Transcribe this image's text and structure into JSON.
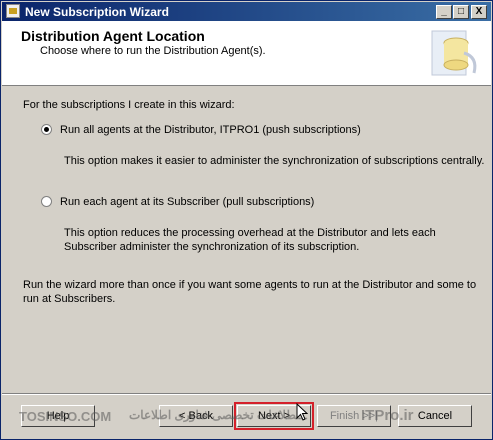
{
  "window": {
    "title": "New Subscription Wizard"
  },
  "title_buttons": {
    "minimize": "_",
    "maximize": "□",
    "close": "X"
  },
  "header": {
    "title": "Distribution Agent Location",
    "subtitle": "Choose where to run the Distribution Agent(s)."
  },
  "main": {
    "intro": "For the subscriptions I create in this wizard:",
    "option1": {
      "label": "Run all agents at the Distributor, ITPRO1 (push subscriptions)",
      "selected": true,
      "description": "This option makes it easier to administer the synchronization of subscriptions centrally."
    },
    "option2": {
      "label": "Run each agent at its Subscriber (pull subscriptions)",
      "selected": false,
      "description_line1": "This option reduces the processing overhead at the Distributor and lets each",
      "description_line2": "Subscriber administer the synchronization of its subscription."
    },
    "note_line1": "Run the wizard more than once if you want some agents to run at the Distributor and some to",
    "note_line2": "run at Subscribers."
  },
  "buttons": {
    "help": "Help",
    "back": "< Back",
    "next": "Next >",
    "finish": "Finish >>|",
    "cancel": "Cancel"
  },
  "watermarks": {
    "left": "TOSINSO.COM",
    "center": "ـــطلاعات تخصصی فناوری اطلاعات",
    "right": "ITPro.ir"
  }
}
